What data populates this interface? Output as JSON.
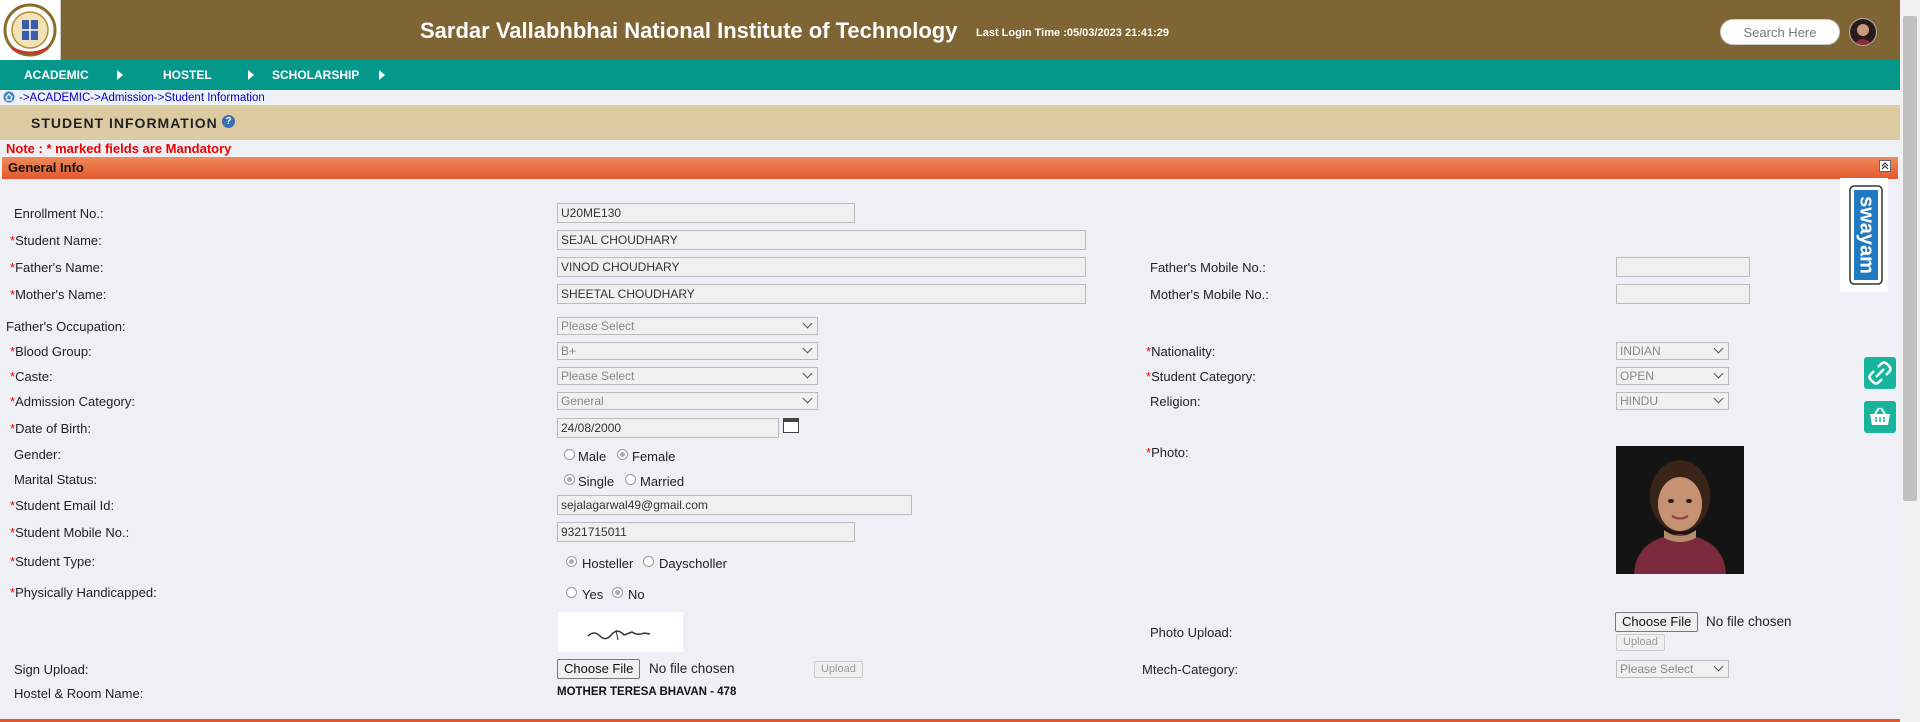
{
  "header": {
    "title": "Sardar Vallabhbhai National Institute of Technology",
    "last_login": "Last Login Time :05/03/2023 21:41:29",
    "search_placeholder": "Search Here"
  },
  "nav": {
    "items": [
      {
        "label": "ACADEMIC"
      },
      {
        "label": "HOSTEL"
      },
      {
        "label": "SCHOLARSHIP"
      }
    ]
  },
  "breadcrumb": "->ACADEMIC->Admission->Student Information",
  "page_title": "STUDENT INFORMATION",
  "help_glyph": "?",
  "note": "Note : * marked fields are Mandatory",
  "section": {
    "title": "General Info"
  },
  "form": {
    "enrollment_label": "Enrollment No.:",
    "enrollment_value": "U20ME130",
    "student_name_label": "Student Name:",
    "student_name_value": "SEJAL CHOUDHARY",
    "father_name_label": "Father's Name:",
    "father_name_value": "VINOD CHOUDHARY",
    "father_mobile_label": "Father's Mobile No.:",
    "father_mobile_value": "",
    "mother_name_label": "Mother's Name:",
    "mother_name_value": "SHEETAL CHOUDHARY",
    "mother_mobile_label": "Mother's Mobile No.:",
    "mother_mobile_value": "",
    "father_occupation_label": "Father's Occupation:",
    "father_occupation_value": "Please Select",
    "blood_group_label": "Blood Group:",
    "blood_group_value": "B+",
    "nationality_label": "Nationality:",
    "nationality_value": "INDIAN",
    "caste_label": "Caste:",
    "caste_value": "Please Select",
    "student_category_label": "Student Category:",
    "student_category_value": "OPEN",
    "admission_category_label": "Admission Category:",
    "admission_category_value": "General",
    "religion_label": "Religion:",
    "religion_value": "HINDU",
    "dob_label": "Date of Birth:",
    "dob_value": "24/08/2000",
    "gender_label": "Gender:",
    "gender_male": "Male",
    "gender_female": "Female",
    "photo_label": "Photo:",
    "marital_label": "Marital Status:",
    "marital_single": "Single",
    "marital_married": "Married",
    "email_label": "Student Email Id:",
    "email_value": "sejalagarwal49@gmail.com",
    "mobile_label": "Student Mobile No.:",
    "mobile_value": "9321715011",
    "student_type_label": "Student Type:",
    "type_hosteller": "Hosteller",
    "type_dayscholler": "Dayscholler",
    "ph_label": "Physically Handicapped:",
    "ph_yes": "Yes",
    "ph_no": "No",
    "photo_upload_label": "Photo Upload:",
    "choose_file": "Choose File",
    "no_file": "No file chosen",
    "upload_label": "Upload",
    "sign_upload_label": "Sign Upload:",
    "mtech_label": "Mtech-Category:",
    "mtech_value": "Please Select",
    "hostel_label": "Hostel & Room Name:",
    "hostel_value": "MOTHER TERESA BHAVAN - 478"
  },
  "required_mark": "*",
  "side_logo": "swayam",
  "icons": [
    "institute-logo",
    "user-avatar-icon",
    "home-icon",
    "help-icon",
    "collapse-icon",
    "calendar-icon",
    "link-icon",
    "basket-icon"
  ],
  "colors": {
    "header": "#7f6434",
    "nav": "#03988a",
    "page_head": "#dccba1",
    "section": "#e2582c",
    "note": "#ee0000",
    "side_buttons": "#18b49b"
  }
}
